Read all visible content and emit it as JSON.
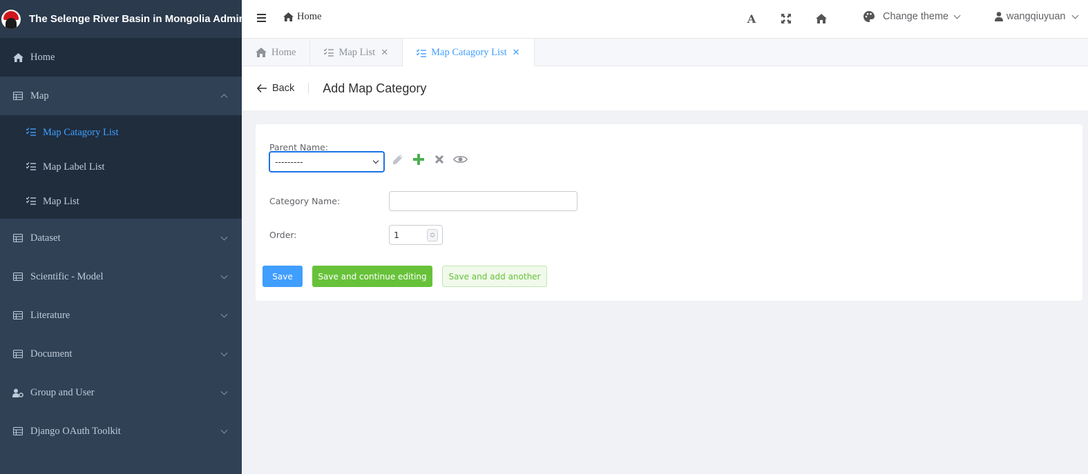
{
  "app": {
    "title": "The Selenge River Basin in Mongolia Admin"
  },
  "sidebar": {
    "items": [
      {
        "label": "Home",
        "icon": "home-icon"
      },
      {
        "label": "Map",
        "icon": "table-icon",
        "expanded": true,
        "children": [
          {
            "label": "Map Catagory List",
            "icon": "list-check-icon",
            "active": true
          },
          {
            "label": "Map Label List",
            "icon": "list-check-icon"
          },
          {
            "label": "Map List",
            "icon": "list-check-icon"
          }
        ]
      },
      {
        "label": "Dataset",
        "icon": "table-icon"
      },
      {
        "label": "Scientific - Model",
        "icon": "table-icon"
      },
      {
        "label": "Literature",
        "icon": "table-icon"
      },
      {
        "label": "Document",
        "icon": "table-icon"
      },
      {
        "label": "Group and User",
        "icon": "user-cog-icon"
      },
      {
        "label": "Django OAuth Toolkit",
        "icon": "table-icon"
      }
    ]
  },
  "header": {
    "breadcrumb": "Home",
    "font_icon_label": "A",
    "theme_label": "Change theme",
    "username": "wangqiuyuan"
  },
  "tabs": [
    {
      "label": "Home",
      "closable": false,
      "active": false
    },
    {
      "label": "Map List",
      "closable": true,
      "active": false
    },
    {
      "label": "Map Catagory List",
      "closable": true,
      "active": true
    }
  ],
  "page": {
    "back_label": "Back",
    "title": "Add Map Category"
  },
  "form": {
    "parent_label": "Parent Name:",
    "parent_value": "---------",
    "category_label": "Category Name:",
    "category_value": "",
    "order_label": "Order:",
    "order_value": "1",
    "save_label": "Save",
    "save_continue_label": "Save and continue editing",
    "save_another_label": "Save and add another"
  },
  "colors": {
    "sidebar_bg": "#304156",
    "accent": "#409eff",
    "success": "#67c23a",
    "focus_border": "#1a73e8"
  }
}
